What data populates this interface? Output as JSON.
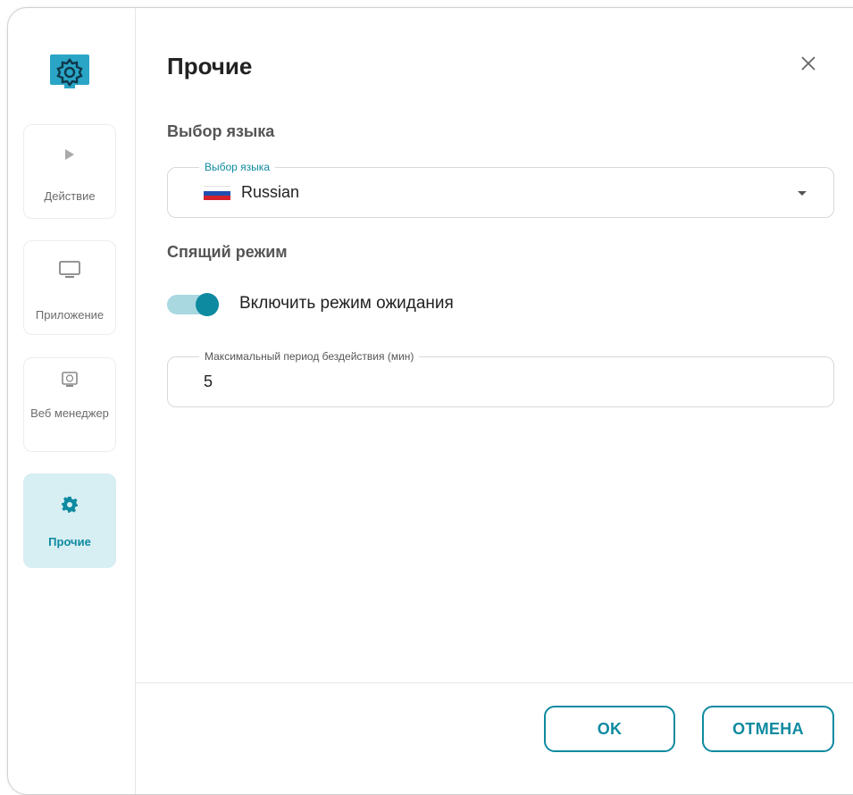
{
  "colors": {
    "accent": "#0e8aa0",
    "toggle_track": "#a9d8e1",
    "active_nav_bg": "#d7eef3"
  },
  "sidebar": {
    "app_icon": "gear-icon",
    "items": [
      {
        "label": "Действие",
        "icon": "play-icon",
        "active": false
      },
      {
        "label": "Приложение",
        "icon": "monitor-icon",
        "active": false
      },
      {
        "label": "Веб менеджер",
        "icon": "web-manager-icon",
        "active": false
      },
      {
        "label": "Прочие",
        "icon": "gear-icon",
        "active": true
      }
    ]
  },
  "header": {
    "title": "Прочие",
    "close_icon": "close-icon"
  },
  "language": {
    "section_label": "Выбор языка",
    "field_legend": "Выбор языка",
    "value": "Russian",
    "flag_icon": "russian-flag-icon"
  },
  "sleep": {
    "section_label": "Спящий режим",
    "toggle_label": "Включить режим ожидания",
    "toggle_on": true,
    "idle_field_legend": "Максимальный период бездействия (мин)",
    "idle_value": "5"
  },
  "footer": {
    "ok_label": "OK",
    "cancel_label": "ОТМЕНА"
  }
}
